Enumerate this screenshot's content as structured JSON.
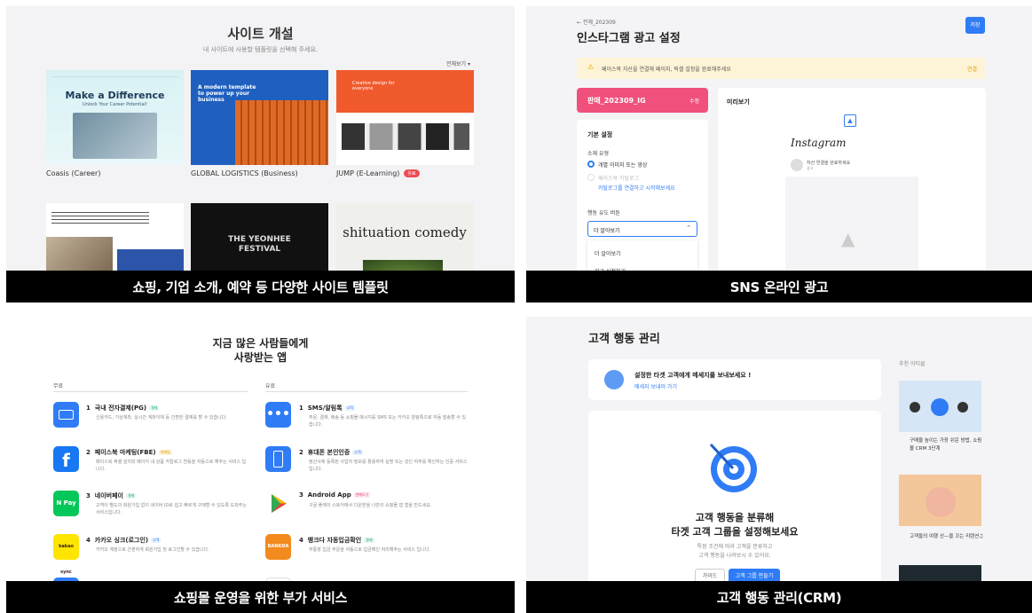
{
  "panel1": {
    "title": "사이트 개설",
    "subtitle": "내 사이트에 사용할 템플릿을 선택해 주세요.",
    "view_all": "전체보기 ▾",
    "templates": [
      {
        "label": "Coasis (Career)",
        "hero": "Make a Difference",
        "sub": "Unlock Your Career Potential!"
      },
      {
        "label": "GLOBAL LOGISTICS (Business)",
        "hero": "A modern template to power up your business"
      },
      {
        "label": "JUMP (E-Learning)",
        "tag": "유료",
        "hero": "Creative design for everyone"
      },
      {
        "label": ""
      },
      {
        "label": "",
        "hero": "THE YEONHEE FESTIVAL"
      },
      {
        "label": "",
        "hero": "shituation comedy"
      }
    ],
    "caption": "쇼핑, 기업 소개, 예약 등 다양한 사이트 템플릿"
  },
  "panel2": {
    "back": "← 전체_202309",
    "title": "인스타그램 광고 설정",
    "save": "저장",
    "notice": "페이스북 자산을 연결해 페이지, 픽셀 설정을 완료해주세요",
    "notice_link": "연결",
    "campaign": "판매_202309_IG",
    "campaign_edit": "수정",
    "basic": "기본 설정",
    "source_label": "소재 유형",
    "radio1": "개별 이미지 또는 영상",
    "radio2": "페이스북 카탈로그",
    "radio2_link": "카탈로그를 연결하고 시작해보세요",
    "cta_label": "행동 유도 버튼",
    "cta_value": "더 알아보기",
    "dropdown": [
      "더 알아보기",
      "지금 신청하기"
    ],
    "preview": "미리보기",
    "insta": "Instagram",
    "preview_text": "자산 연결을 완료하세요",
    "preview_sub": "광고",
    "caption": "SNS 온라인 광고"
  },
  "panel3": {
    "title": "지금 많은 사람들에게\n사랑받는 앱",
    "free": "무료",
    "paid": "유료",
    "free_apps": [
      {
        "no": "1",
        "name": "국내 전자결제(PG)",
        "tag": "결제",
        "desc": "신용카드, 가상계좌, 실시간 계좌이체 등 간편한 결제를 할 수 있습니다."
      },
      {
        "no": "2",
        "name": "페이스북 마케팅(FBE)",
        "tag": "마케팅",
        "desc": "페이스북 픽셀 설치와 페이지 내 상품 카탈로그 연동을 자동으로 해주는 서비스 입니다."
      },
      {
        "no": "3",
        "name": "네이버페이",
        "tag": "결제",
        "desc": "고객이 별도의 회원가입 없이 네이버 ID로 쉽고 빠르게 구매할 수 있도록 도와주는 서비스입니다."
      },
      {
        "no": "4",
        "name": "카카오 싱크(로그인)",
        "tag": "고객",
        "desc": "카카오 계정으로 간편하게 회원가입 및 로그인할 수 있습니다."
      }
    ],
    "paid_apps": [
      {
        "no": "1",
        "name": "SMS/알림톡",
        "tag": "고객",
        "desc": "주문, 결제, 배송 등 쇼핑몰 메시지를 SMS 또는 카카오 알림톡으로 자동 발송할 수 있습니다."
      },
      {
        "no": "2",
        "name": "휴대폰 본인인증",
        "tag": "고객",
        "desc": "정산사에 등록된 사업자 정보를 활용하여 실명 또는 성인 여부를 확인하는 인증 서비스입니다."
      },
      {
        "no": "3",
        "name": "Android App",
        "tag": "판매도구",
        "desc": "구글 플레이 스토어에서 다운받을 나만의 쇼핑몰 앱 앱을 만드세요."
      },
      {
        "no": "4",
        "name": "뱅크다 자동입금확인",
        "tag": "결제",
        "desc": "무통장 입금 주문을 자동으로 입금확인 처리해주는 서비스 입니다."
      }
    ],
    "caption": "쇼핑몰 운영을 위한 부가 서비스"
  },
  "panel4": {
    "title": "고객 행동 관리",
    "banner": "설정한 타겟 고객에게 메세지를 보내보세요 !",
    "banner_link": "메세지 보내러 가기",
    "main1": "고객 행동을 분류해",
    "main2": "타겟 고객 그룹을 설정해보세요",
    "desc1": "특정 조건에 따라 고객을 분류하고",
    "desc2": "고객 행동을 나려보시 수 있어요.",
    "guide": "가이드",
    "create": "고객 그룹 만들기",
    "side_title": "추천 아티클",
    "article1": "구매율 높이는 가장 쉬운 방법, 쇼핑몰 CRM 3단계",
    "article2": "고객들의 여행 선—을 꼬는 리텐션♫",
    "caption": "고객 행동 관리(CRM)"
  },
  "colors": {
    "accent": "#2f7cf6",
    "pink": "#f0507c",
    "caption_bg": "#000000"
  }
}
